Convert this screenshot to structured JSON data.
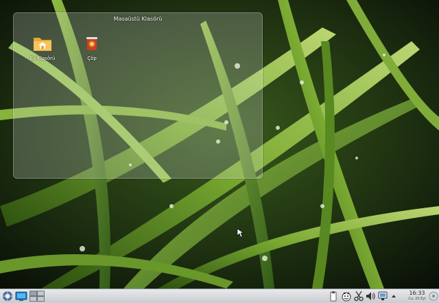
{
  "desktop": {
    "wallpaper": "wet-grass-wallpaper",
    "folder_view": {
      "title": "Masaüstü Klasörü",
      "icons": [
        {
          "label": "Ev Klasörü",
          "icon": "home-folder-icon"
        },
        {
          "label": "Çöp",
          "icon": "trash-icon"
        }
      ]
    }
  },
  "taskbar": {
    "launcher_icon": "kde-launcher-icon",
    "show_desktop_icon": "show-desktop-icon",
    "pager_icon": "pager-icon",
    "tray_icons": [
      "clipboard-icon",
      "device-notifier-icon",
      "scissors-icon",
      "volume-icon",
      "network-icon",
      "battery-icon",
      "expand-tray-icon"
    ],
    "clock": {
      "time": "16:33",
      "date": "Cu, 20 Eyl"
    },
    "cashew_icon": "panel-toolbox-icon"
  },
  "colors": {
    "panel": "#dcdee2",
    "accent": "#3aa0d8"
  }
}
